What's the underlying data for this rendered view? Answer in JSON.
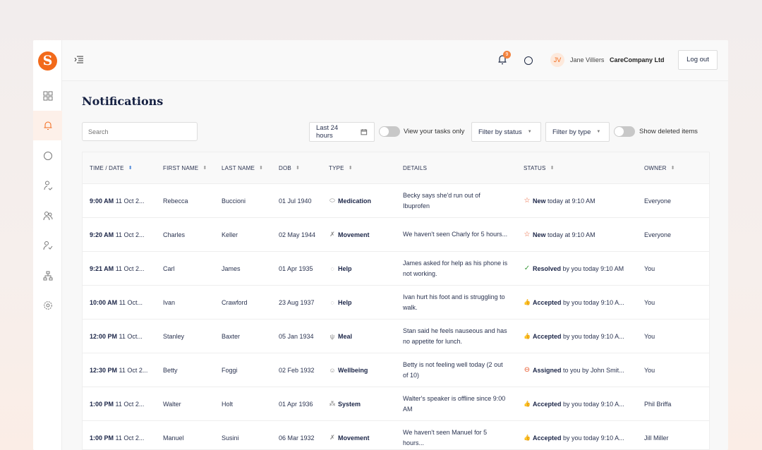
{
  "app": {
    "logo_letter": "S",
    "accent": "#f26a1b"
  },
  "topbar": {
    "notif_count": "9",
    "avatar_initials": "JV",
    "user_name": "Jane Villiers",
    "company": "CareCompany Ltd",
    "logout": "Log out"
  },
  "page": {
    "title": "Notifications"
  },
  "filters": {
    "search_placeholder": "Search",
    "date_range": "Last 24 hours",
    "view_tasks": "View your tasks only",
    "status": "Filter by status",
    "type": "Filter by type",
    "deleted": "Show deleted items"
  },
  "table": {
    "headers": [
      "TIME / DATE",
      "FIRST NAME",
      "LAST NAME",
      "DOB",
      "TYPE",
      "DETAILS",
      "STATUS",
      "OWNER"
    ],
    "rows": [
      {
        "time": "9:00 AM",
        "date": "11 Oct 2...",
        "first": "Rebecca",
        "last": "Buccioni",
        "dob": "01 Jul 1940",
        "type_icon": "pill-icon",
        "type": "Medication",
        "details": "Becky says she'd run out of Ibuprofen",
        "status_icon": "star-icon",
        "status": "New",
        "status_rest": "today at 9:10 AM",
        "owner": "Everyone"
      },
      {
        "time": "9:20 AM",
        "date": "11 Oct 2...",
        "first": "Charles",
        "last": "Keller",
        "dob": "02 May 1944",
        "type_icon": "movement-icon",
        "type": "Movement",
        "details": "We haven't seen Charly for 5 hours...",
        "status_icon": "star-icon",
        "status": "New",
        "status_rest": "today at 9:10 AM",
        "owner": "Everyone"
      },
      {
        "time": "9:21 AM",
        "date": "11 Oct 2...",
        "first": "Carl",
        "last": "James",
        "dob": "01 Apr 1935",
        "type_icon": "help-icon",
        "type": "Help",
        "details": "James asked for help as his phone is not working.",
        "status_icon": "check-icon",
        "status": "Resolved",
        "status_rest": "by you today 9:10 AM",
        "owner": "You"
      },
      {
        "time": "10:00 AM",
        "date": "11 Oct...",
        "first": "Ivan",
        "last": "Crawford",
        "dob": "23 Aug 1937",
        "type_icon": "help-icon",
        "type": "Help",
        "details": "Ivan hurt his foot and is struggling to walk.",
        "status_icon": "thumbs-up-icon",
        "status": "Accepted",
        "status_rest": "by you today 9:10 A...",
        "owner": "You"
      },
      {
        "time": "12:00 PM",
        "date": "11 Oct...",
        "first": "Stanley",
        "last": "Baxter",
        "dob": "05 Jan 1934",
        "type_icon": "meal-icon",
        "type": "Meal",
        "details": "Stan said he feels nauseous and has no appetite for lunch.",
        "status_icon": "thumbs-up-icon",
        "status": "Accepted",
        "status_rest": "by you today 9:10 A...",
        "owner": "You"
      },
      {
        "time": "12:30 PM",
        "date": "11 Oct 2...",
        "first": "Betty",
        "last": "Foggi",
        "dob": "02 Feb 1932",
        "type_icon": "wellbeing-icon",
        "type": "Wellbeing",
        "details": "Betty is not feeling well today (2 out of 10)",
        "status_icon": "assigned-icon",
        "status": "Assigned",
        "status_rest": "to you by John Smit...",
        "owner": "You"
      },
      {
        "time": "1:00 PM",
        "date": "11 Oct 2...",
        "first": "Walter",
        "last": "Holt",
        "dob": "01 Apr 1936",
        "type_icon": "system-icon",
        "type": "System",
        "details": "Walter's speaker is offline since 9:00 AM",
        "status_icon": "thumbs-up-icon",
        "status": "Accepted",
        "status_rest": "by you today 9:10 A...",
        "owner": "Phil Briffa"
      },
      {
        "time": "1:00 PM",
        "date": "11 Oct 2...",
        "first": "Manuel",
        "last": "Susini",
        "dob": "06 Mar 1932",
        "type_icon": "movement-icon",
        "type": "Movement",
        "details": "We haven't seen Manuel for 5 hours...",
        "status_icon": "thumbs-up-icon",
        "status": "Accepted",
        "status_rest": "by you today 9:10 A...",
        "owner": "Jill Miller"
      }
    ]
  }
}
